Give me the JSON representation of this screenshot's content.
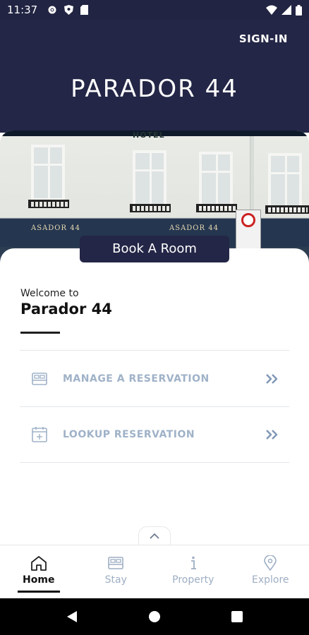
{
  "status_bar": {
    "time": "11:37"
  },
  "header": {
    "sign_in_label": "SIGN-IN",
    "logo_text": "PARADOR 44"
  },
  "hero": {
    "hotel_sign": "HOTEL",
    "shop_text_left": "ASADOR 44",
    "shop_text_right": "ASADOR 44"
  },
  "book_button_label": "Book A Room",
  "welcome": {
    "subtitle": "Welcome to",
    "title": "Parador 44"
  },
  "menu": [
    {
      "label": "MANAGE A RESERVATION",
      "icon": "bed-icon"
    },
    {
      "label": "LOOKUP RESERVATION",
      "icon": "calendar-add-icon"
    }
  ],
  "tabs": [
    {
      "label": "Home",
      "icon": "home-icon",
      "active": true
    },
    {
      "label": "Stay",
      "icon": "bed-icon",
      "active": false
    },
    {
      "label": "Property",
      "icon": "info-icon",
      "active": false
    },
    {
      "label": "Explore",
      "icon": "location-pin-icon",
      "active": false
    }
  ],
  "colors": {
    "navy": "#232646",
    "menu_text": "#9fb2c8",
    "tab_inactive": "#9eaec3"
  }
}
